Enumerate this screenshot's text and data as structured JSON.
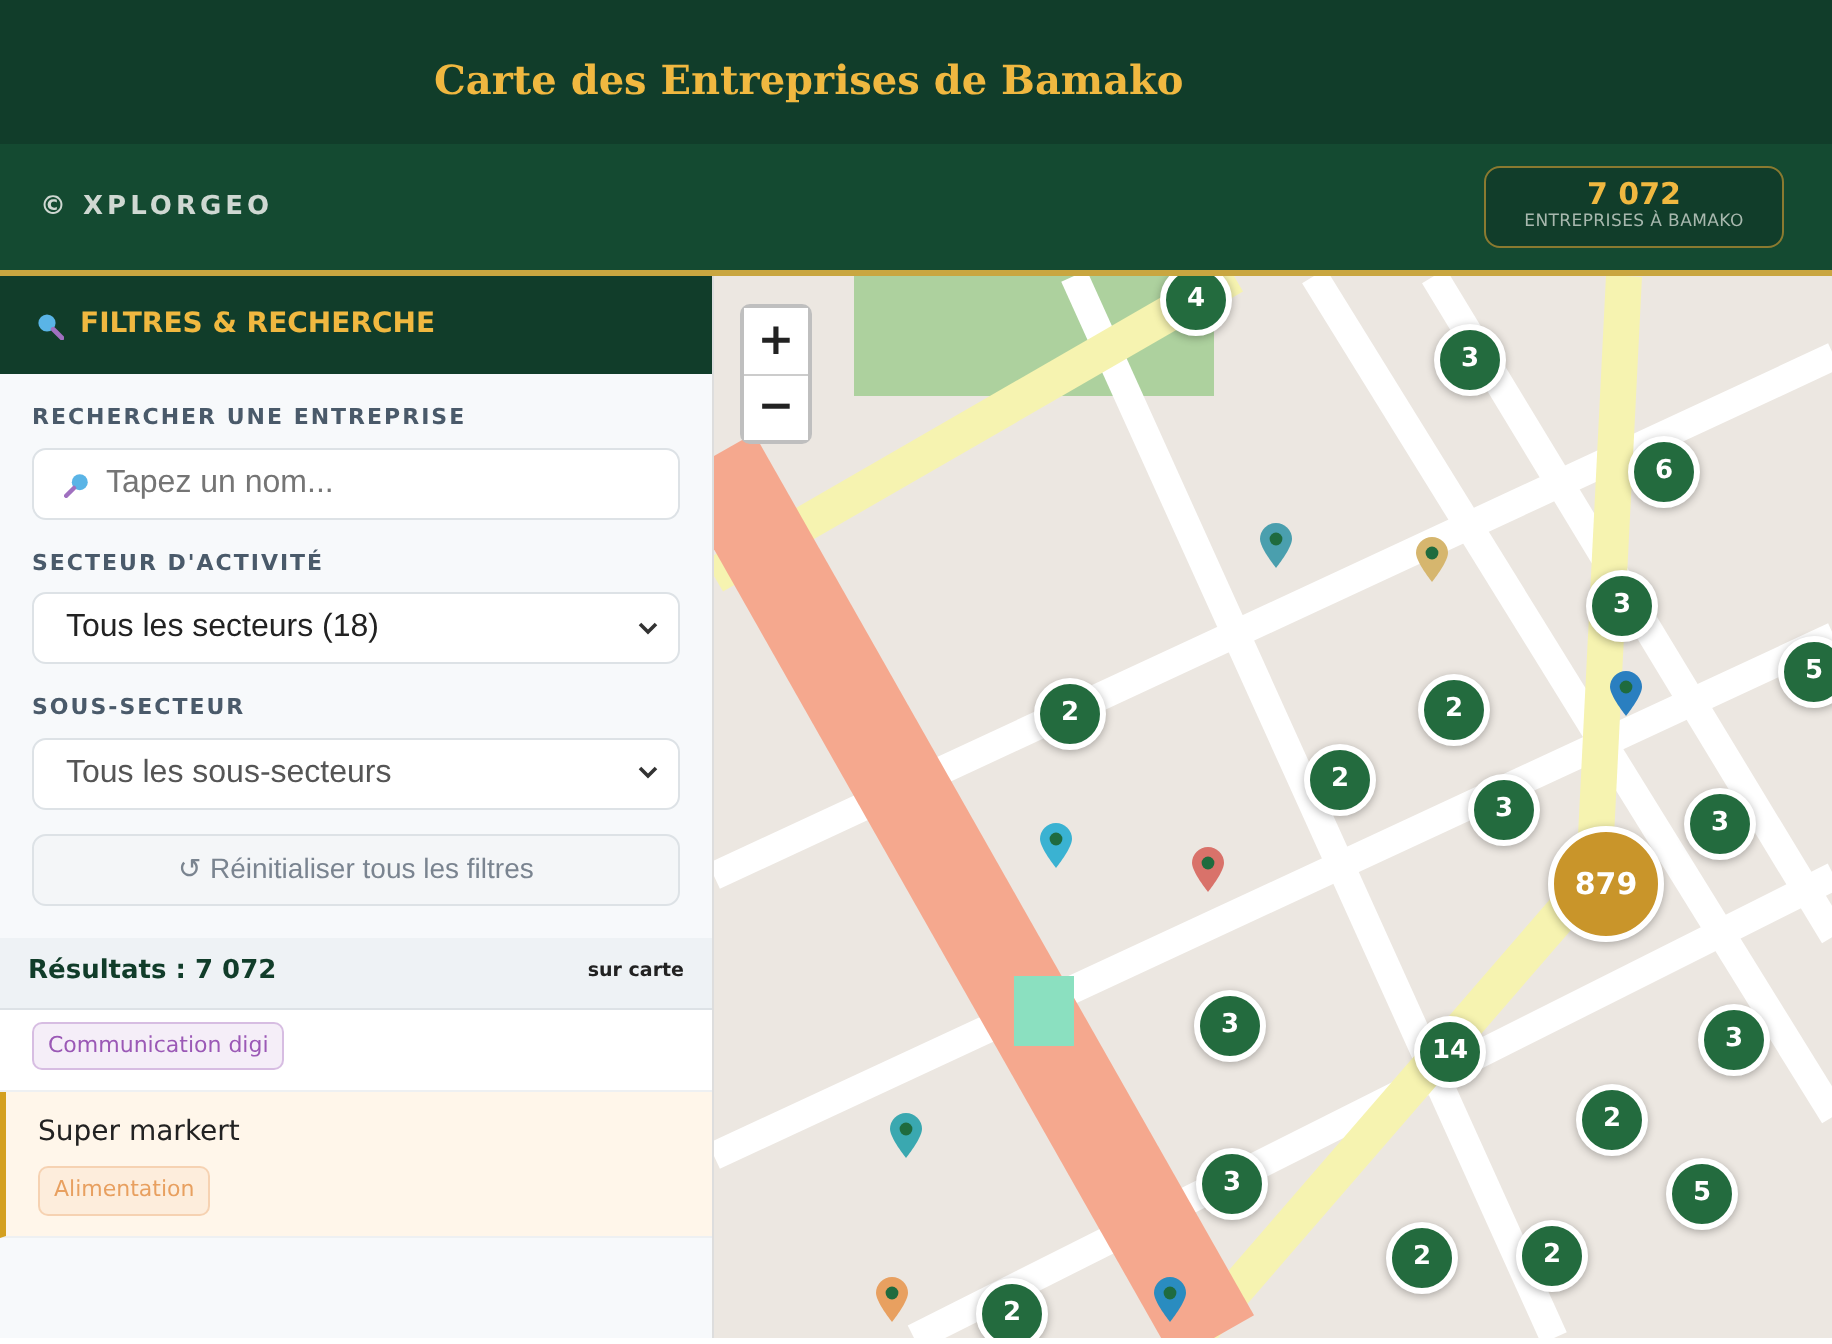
{
  "header": {
    "title": "Carte des Entreprises de Bamako",
    "brand": "© XPLORGEO",
    "stat": {
      "value": "7 072",
      "label": "ENTREPRISES À BAMAKO"
    }
  },
  "sidebar": {
    "title": "FILTRES & RECHERCHE",
    "fields": [
      {
        "kind": "search",
        "label": "RECHERCHER UNE ENTREPRISE",
        "placeholder": "Tapez un nom..."
      },
      {
        "kind": "select",
        "label": "SECTEUR D'ACTIVITÉ",
        "value": "Tous les secteurs (18)"
      },
      {
        "kind": "select",
        "label": "SOUS-SECTEUR",
        "value": "Tous les sous-secteurs"
      }
    ],
    "reset_button": "↺ Réinitialiser tous les filtres",
    "results": {
      "count": "Résultats : 7 072",
      "note": "sur carte"
    },
    "items": [
      {
        "tag": "Communication digi",
        "color": "#9b59b6",
        "selected": false
      },
      {
        "name": "Super markert",
        "tag": "Alimentation",
        "color": "#e8a060",
        "selected": true
      }
    ]
  },
  "map": {
    "zoom_in": "+",
    "zoom_out": "−",
    "clusters": [
      {
        "count": "4",
        "kind": "small"
      },
      {
        "count": "3",
        "kind": "small"
      },
      {
        "count": "6",
        "kind": "small"
      },
      {
        "count": "3",
        "kind": "small"
      },
      {
        "count": "5",
        "kind": "small"
      },
      {
        "count": "2",
        "kind": "small"
      },
      {
        "count": "2",
        "kind": "small"
      },
      {
        "count": "2",
        "kind": "small"
      },
      {
        "count": "3",
        "kind": "small"
      },
      {
        "count": "3",
        "kind": "small"
      },
      {
        "count": "879",
        "kind": "large"
      },
      {
        "count": "3",
        "kind": "small"
      },
      {
        "count": "14",
        "kind": "small"
      },
      {
        "count": "3",
        "kind": "small"
      },
      {
        "count": "2",
        "kind": "small"
      },
      {
        "count": "5",
        "kind": "small"
      },
      {
        "count": "3",
        "kind": "small"
      },
      {
        "count": "2",
        "kind": "small"
      },
      {
        "count": "2",
        "kind": "small"
      },
      {
        "count": "2",
        "kind": "small"
      }
    ],
    "pins": [
      {
        "color": "#4a9fae"
      },
      {
        "color": "#d6b66e"
      },
      {
        "color": "#2a7fc0"
      },
      {
        "color": "#3ab2d2"
      },
      {
        "color": "#d9726a"
      },
      {
        "color": "#3aa8b0"
      },
      {
        "color": "#2a8cc0"
      },
      {
        "color": "#e8a060"
      }
    ]
  }
}
